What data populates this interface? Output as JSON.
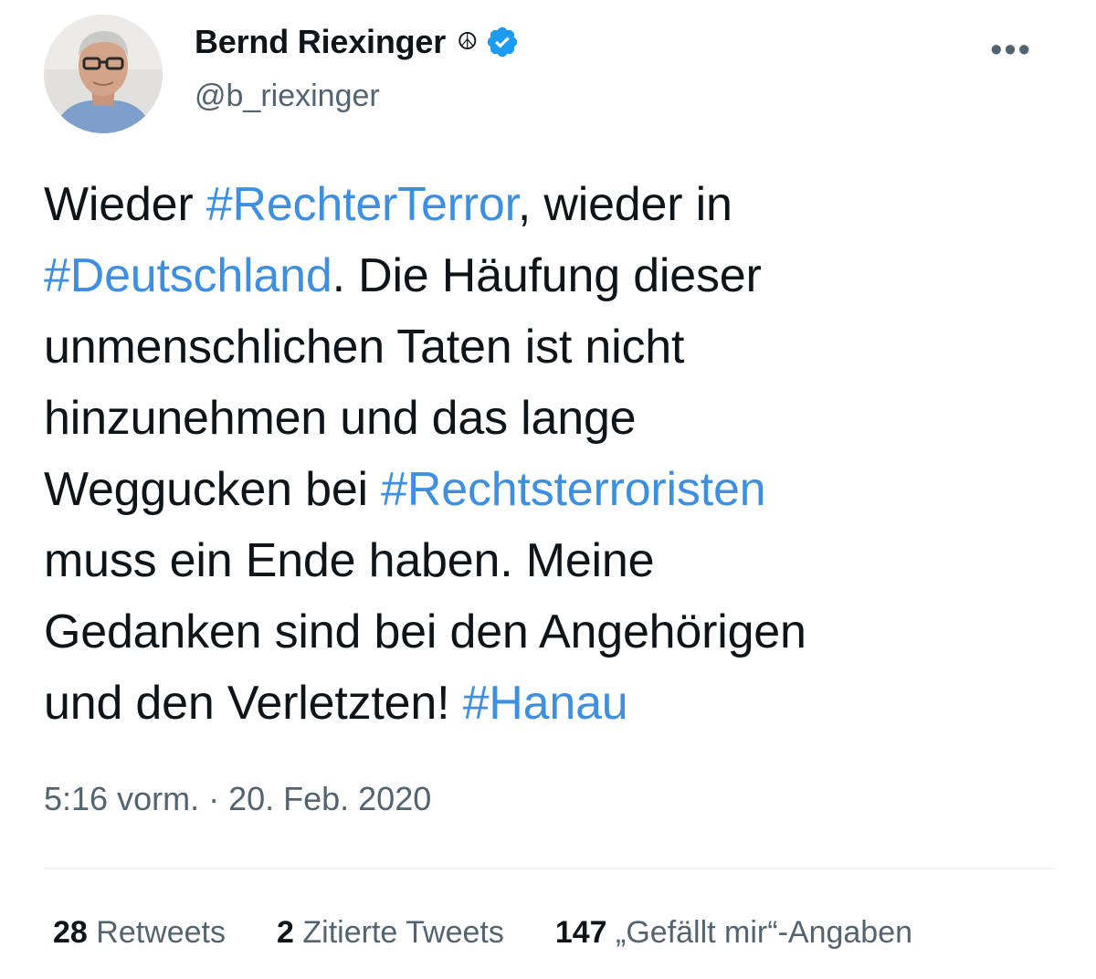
{
  "user": {
    "display_name": "Bernd Riexinger",
    "emoji": "☮",
    "handle": "@b_riexinger",
    "verified": true,
    "avatar_icon": "profile-photo"
  },
  "menu": {
    "more_label": "•••"
  },
  "tweet": {
    "lines": [
      [
        {
          "text": "Wieder "
        },
        {
          "text": "#RechterTerror",
          "hashtag": true
        },
        {
          "text": ", wieder in"
        }
      ],
      [
        {
          "text": "#Deutschland",
          "hashtag": true
        },
        {
          "text": ". Die Häufung dieser"
        }
      ],
      [
        {
          "text": "unmenschlichen Taten ist nicht"
        }
      ],
      [
        {
          "text": "hinzunehmen und das lange"
        }
      ],
      [
        {
          "text": "Weggucken bei "
        },
        {
          "text": "#Rechtsterroristen",
          "hashtag": true
        }
      ],
      [
        {
          "text": "muss ein Ende haben. Meine"
        }
      ],
      [
        {
          "text": "Gedanken sind bei den Angehörigen"
        }
      ],
      [
        {
          "text": "und den Verletzten! "
        },
        {
          "text": "#Hanau",
          "hashtag": true
        }
      ]
    ]
  },
  "meta": {
    "time": "5:16 vorm.",
    "separator": " · ",
    "date": "20. Feb. 2020"
  },
  "stats": {
    "retweets": {
      "count": "28",
      "label": " Retweets"
    },
    "quotes": {
      "count": "2",
      "label": " Zitierte Tweets"
    },
    "likes": {
      "count": "147",
      "label": " „Gefällt mir“-Angaben"
    }
  },
  "colors": {
    "hashtag": "#3f8fe0",
    "verified_badge": "#1d9bf0",
    "secondary_text": "#536471",
    "primary_text": "#0f1419"
  }
}
